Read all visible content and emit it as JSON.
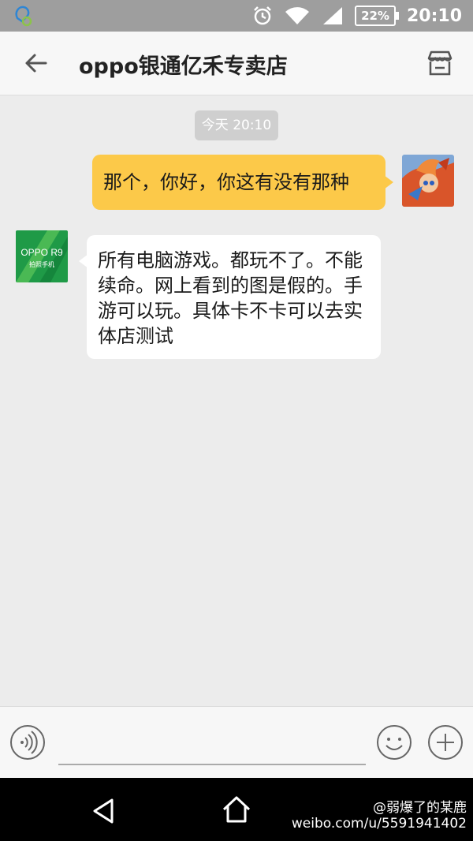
{
  "status_bar": {
    "battery": "22%",
    "time": "20:10",
    "icons": [
      "notification-icon",
      "alarm-icon",
      "wifi-icon",
      "signal-icon",
      "battery-icon"
    ]
  },
  "header": {
    "title": "oppo银通亿禾专卖店",
    "back_icon": "arrow-left-icon",
    "store_icon": "store-icon"
  },
  "chat": {
    "timestamp": "今天 20:10",
    "messages": [
      {
        "from": "self",
        "text": "那个，你好，你这有没有那种"
      },
      {
        "from": "shop",
        "text": "所有电脑游戏。都玩不了。不能续命。网上看到的图是假的。手游可以玩。具体卡不卡可以去实体店测试"
      }
    ],
    "shop_avatar_text": {
      "brand": "OPPO R9",
      "tagline": "拍照手机"
    },
    "colors": {
      "outgoing": "#fcc949",
      "incoming": "#ffffff",
      "background": "#ececec"
    }
  },
  "input_bar": {
    "placeholder": "",
    "icons": [
      "voice-icon",
      "emoji-icon",
      "plus-icon"
    ]
  },
  "nav_bar": {
    "icons": [
      "nav-back-icon",
      "nav-home-icon"
    ]
  },
  "watermark": {
    "handle": "@弱爆了的某鹿",
    "url": "weibo.com/u/5591941402"
  }
}
